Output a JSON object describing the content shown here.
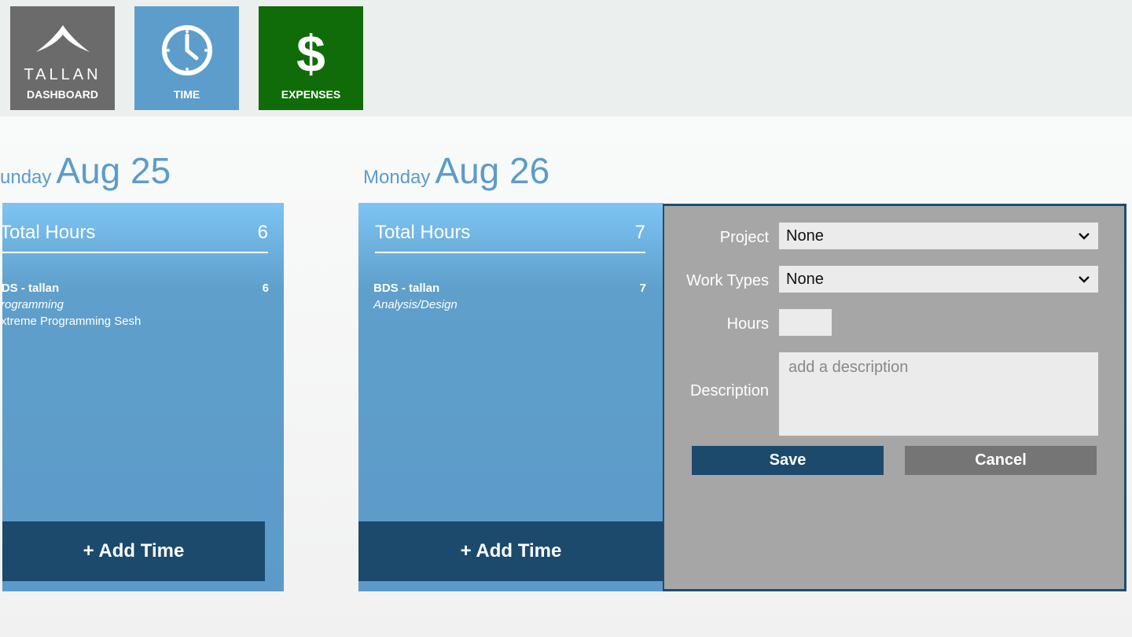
{
  "nav": {
    "dashboard": {
      "logo": "TALLAN",
      "label": "DASHBOARD"
    },
    "time": {
      "label": "TIME"
    },
    "expenses": {
      "symbol": "$",
      "label": "EXPENSES"
    }
  },
  "days": [
    {
      "weekday": "unday",
      "date": "Aug 25",
      "total_label": "Total Hours",
      "total_value": "6",
      "entries": [
        {
          "project": "BDS - tallan",
          "hours": "6",
          "work_type": "Programming",
          "description": "Extreme Programming Sesh"
        }
      ],
      "add_label": "+ Add Time"
    },
    {
      "weekday": "Monday",
      "date": "Aug 26",
      "total_label": "Total Hours",
      "total_value": "7",
      "entries": [
        {
          "project": "BDS - tallan",
          "hours": "7",
          "work_type": "Analysis/Design"
        }
      ],
      "add_label": "+ Add Time"
    }
  ],
  "form": {
    "project_label": "Project",
    "project_value": "None",
    "work_types_label": "Work Types",
    "work_types_value": "None",
    "hours_label": "Hours",
    "hours_value": "",
    "description_label": "Description",
    "description_placeholder": "add a description",
    "save_label": "Save",
    "cancel_label": "Cancel"
  },
  "colors": {
    "accent_blue": "#5d9dcc",
    "dark_blue": "#1c4a6c",
    "expenses_green": "#106c08",
    "dashboard_gray": "#6b6b6b",
    "panel_gray": "#a6a6a6"
  }
}
